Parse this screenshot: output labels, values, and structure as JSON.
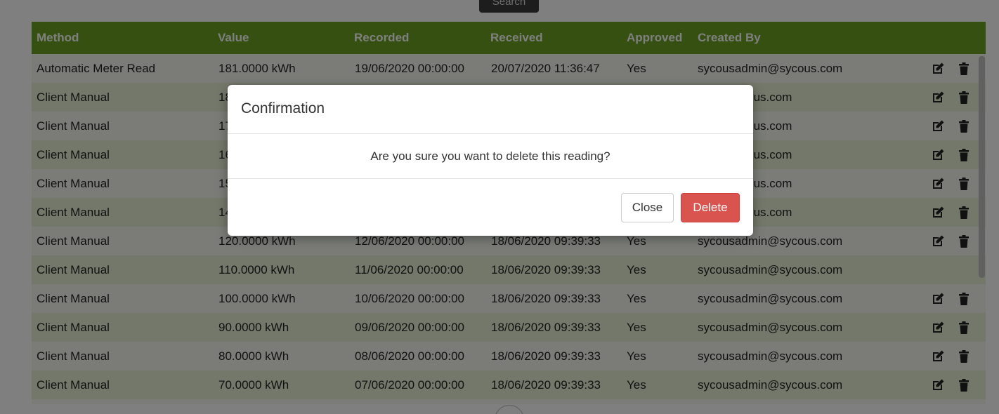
{
  "search_button": "Search",
  "table": {
    "headers": [
      "Method",
      "Value",
      "Recorded",
      "Received",
      "Approved",
      "Created By"
    ],
    "rows": [
      {
        "method": "Automatic Meter Read",
        "value": "181.0000 kWh",
        "recorded": "19/06/2020 00:00:00",
        "received": "20/07/2020 11:36:47",
        "approved": "Yes",
        "created_by": "sycousadmin@sycous.com",
        "actions": true
      },
      {
        "method": "Client Manual",
        "value": "18",
        "recorded": "",
        "received": "",
        "approved": "",
        "created_by": "min@sycous.com",
        "actions": true
      },
      {
        "method": "Client Manual",
        "value": "17",
        "recorded": "",
        "received": "",
        "approved": "",
        "created_by": "min@sycous.com",
        "actions": true
      },
      {
        "method": "Client Manual",
        "value": "16",
        "recorded": "",
        "received": "",
        "approved": "",
        "created_by": "min@sycous.com",
        "actions": true
      },
      {
        "method": "Client Manual",
        "value": "15",
        "recorded": "",
        "received": "",
        "approved": "",
        "created_by": "min@sycous.com",
        "actions": true
      },
      {
        "method": "Client Manual",
        "value": "14",
        "recorded": "",
        "received": "",
        "approved": "",
        "created_by": "min@sycous.com",
        "actions": true
      },
      {
        "method": "Client Manual",
        "value": "120.0000 kWh",
        "recorded": "12/06/2020 00:00:00",
        "received": "18/06/2020 09:39:33",
        "approved": "Yes",
        "created_by": "sycousadmin@sycous.com",
        "actions": true
      },
      {
        "method": "Client Manual",
        "value": "110.0000 kWh",
        "recorded": "11/06/2020 00:00:00",
        "received": "18/06/2020 09:39:33",
        "approved": "Yes",
        "created_by": "sycousadmin@sycous.com",
        "actions": false
      },
      {
        "method": "Client Manual",
        "value": "100.0000 kWh",
        "recorded": "10/06/2020 00:00:00",
        "received": "18/06/2020 09:39:33",
        "approved": "Yes",
        "created_by": "sycousadmin@sycous.com",
        "actions": true
      },
      {
        "method": "Client Manual",
        "value": "90.0000 kWh",
        "recorded": "09/06/2020 00:00:00",
        "received": "18/06/2020 09:39:33",
        "approved": "Yes",
        "created_by": "sycousadmin@sycous.com",
        "actions": true
      },
      {
        "method": "Client Manual",
        "value": "80.0000 kWh",
        "recorded": "08/06/2020 00:00:00",
        "received": "18/06/2020 09:39:33",
        "approved": "Yes",
        "created_by": "sycousadmin@sycous.com",
        "actions": true
      },
      {
        "method": "Client Manual",
        "value": "70.0000 kWh",
        "recorded": "07/06/2020 00:00:00",
        "received": "18/06/2020 09:39:33",
        "approved": "Yes",
        "created_by": "sycousadmin@sycous.com",
        "actions": true
      }
    ]
  },
  "modal": {
    "title": "Confirmation",
    "message": "Are you sure you want to delete this reading?",
    "close_label": "Close",
    "delete_label": "Delete"
  },
  "colors": {
    "header_green": "#6aa121",
    "delete_red": "#d9534f"
  },
  "icons": {
    "edit": "edit-icon",
    "delete": "trash-icon"
  }
}
